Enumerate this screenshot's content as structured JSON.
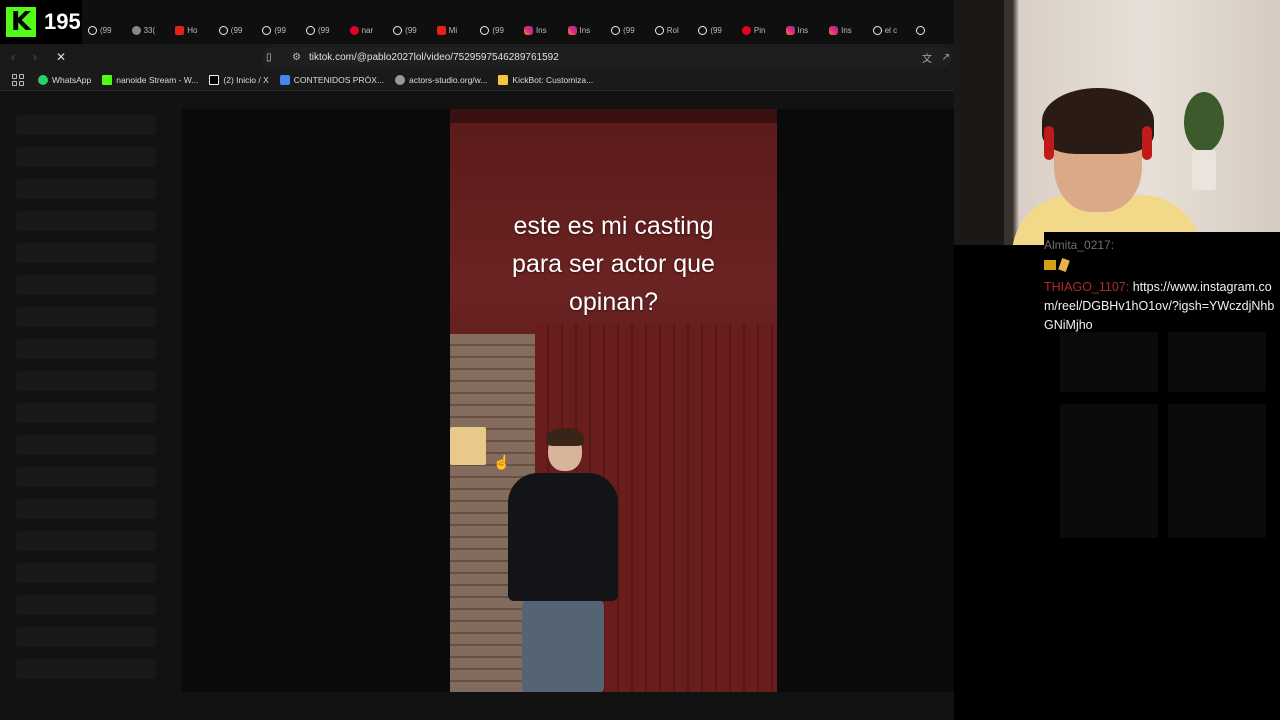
{
  "kick": {
    "logo": "K",
    "viewer_count": "195"
  },
  "tabs": [
    {
      "icon": "tiktok-icon",
      "label": "(99"
    },
    {
      "icon": "globe-icon",
      "label": "33("
    },
    {
      "icon": "youtube-icon",
      "label": "Ho"
    },
    {
      "icon": "tiktok-icon",
      "label": "(99"
    },
    {
      "icon": "tiktok-icon",
      "label": "(99"
    },
    {
      "icon": "tiktok-icon",
      "label": "(99"
    },
    {
      "icon": "pinterest-icon",
      "label": "nar"
    },
    {
      "icon": "tiktok-icon",
      "label": "(99"
    },
    {
      "icon": "youtube-icon",
      "label": "Mi"
    },
    {
      "icon": "tiktok-icon",
      "label": "(99"
    },
    {
      "icon": "instagram-icon",
      "label": "Ins"
    },
    {
      "icon": "instagram-icon",
      "label": "Ins"
    },
    {
      "icon": "tiktok-icon",
      "label": "(99"
    },
    {
      "icon": "tiktok-icon",
      "label": "Rol"
    },
    {
      "icon": "tiktok-icon",
      "label": "(99"
    },
    {
      "icon": "pinterest-icon",
      "label": "Pin"
    },
    {
      "icon": "instagram-icon",
      "label": "Ins"
    },
    {
      "icon": "instagram-icon",
      "label": "Ins"
    },
    {
      "icon": "tiktok-icon",
      "label": "el c"
    },
    {
      "icon": "tiktok-icon",
      "label": ""
    }
  ],
  "toolbar": {
    "back": "‹",
    "forward": "›",
    "reload": "✕",
    "url": "tiktok.com/@pablo2027lol/video/7529597546289761592"
  },
  "bookmarks": [
    {
      "icon": "whatsapp-icon",
      "label": "WhatsApp"
    },
    {
      "icon": "kick-icon",
      "label": "nanoide Stream - W..."
    },
    {
      "icon": "x-icon",
      "label": "(2) Inicio / X"
    },
    {
      "icon": "docs-icon",
      "label": "CONTENIDOS PRÓX..."
    },
    {
      "icon": "globe-icon",
      "label": "actors-studio.org/w..."
    },
    {
      "icon": "kickbot-icon",
      "label": "KickBot: Customiza..."
    }
  ],
  "video": {
    "caption_lines": [
      "este es mi casting",
      "para ser actor que",
      "opinan?"
    ]
  },
  "chat": {
    "partial_user": "Almita_0217:",
    "message": {
      "user": "THIAGO_1107:",
      "text": "https://www.instagram.com/reel/DGBHv1hO1ov/?igsh=YWczdjNhbGNiMjho"
    }
  },
  "colors": {
    "kick_green": "#53fc18",
    "chat_username": "#b02a2a",
    "background": "#000000"
  }
}
